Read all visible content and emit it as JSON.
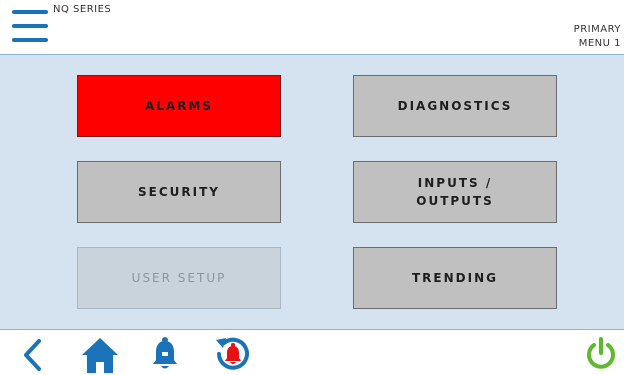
{
  "header": {
    "series_label": "NQ SERIES",
    "page_label_line1": "PRIMARY",
    "page_label_line2": "MENU 1"
  },
  "menu": {
    "alarms": "ALARMS",
    "diagnostics": "DIAGNOSTICS",
    "security": "SECURITY",
    "inputs_outputs": "INPUTS /\nOUTPUTS",
    "user_setup": "USER SETUP",
    "trending": "TRENDING"
  },
  "footer": {
    "icons": [
      "back-arrow-icon",
      "home-icon",
      "bell-icon",
      "alarm-history-icon",
      "power-icon"
    ]
  },
  "colors": {
    "accent_blue": "#1a73b8",
    "alarm_red": "#ff0000",
    "background": "#d4e3ef",
    "power_green": "#5fb82e"
  }
}
